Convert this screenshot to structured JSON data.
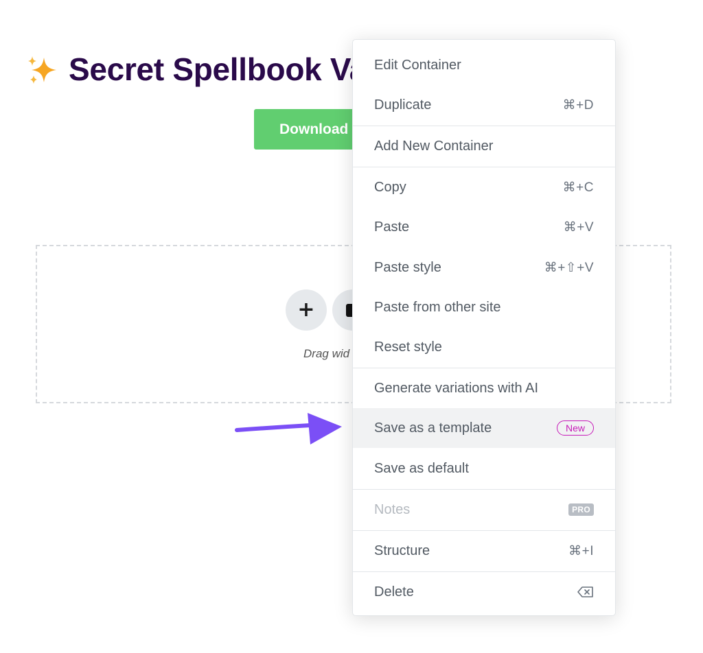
{
  "page": {
    "title": "Secret Spellbook Va",
    "download_label": "Download",
    "add_symbol": "+",
    "drag_hint": "Drag wid"
  },
  "menu": {
    "items": [
      {
        "label": "Edit Container",
        "shortcut": ""
      },
      {
        "label": "Duplicate",
        "shortcut": "⌘+D"
      },
      {
        "label": "Add New Container",
        "shortcut": ""
      },
      {
        "label": "Copy",
        "shortcut": "⌘+C"
      },
      {
        "label": "Paste",
        "shortcut": "⌘+V"
      },
      {
        "label": "Paste style",
        "shortcut": "⌘+⇧+V"
      },
      {
        "label": "Paste from other site",
        "shortcut": ""
      },
      {
        "label": "Reset style",
        "shortcut": ""
      },
      {
        "label": "Generate variations with AI",
        "shortcut": ""
      },
      {
        "label": "Save as a template",
        "badge": "New"
      },
      {
        "label": "Save as default",
        "shortcut": ""
      },
      {
        "label": "Notes",
        "badge": "PRO"
      },
      {
        "label": "Structure",
        "shortcut": "⌘+I"
      },
      {
        "label": "Delete",
        "icon": "clear-key-icon"
      }
    ]
  },
  "colors": {
    "title": "#2a0a4a",
    "download_button": "#61ce70",
    "arrow": "#7b4ff6",
    "new_badge": "#c61ab8",
    "pro_badge": "#b8bdc4",
    "menu_text": "#515962"
  },
  "icons": {
    "sparkles": "sparkles-icon",
    "add": "plus-icon",
    "folder": "folder-icon",
    "arrow": "arrow-right-icon",
    "delete": "clear-key-icon"
  }
}
